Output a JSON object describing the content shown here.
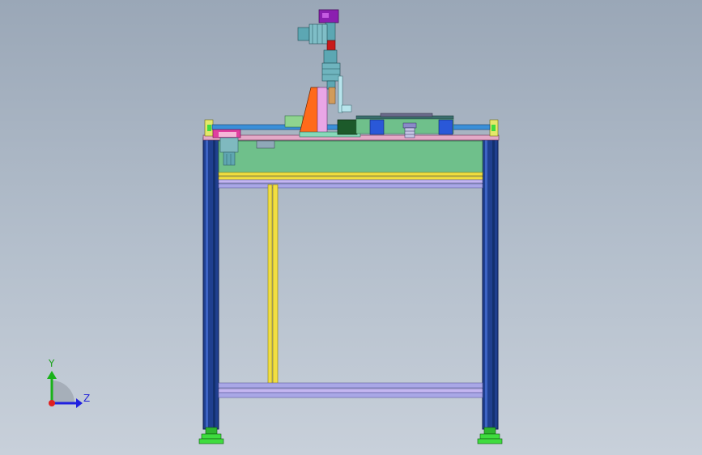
{
  "viewport": {
    "background_top": "#9aa7b7",
    "background_bottom": "#c8d0da"
  },
  "triad": {
    "y_label": "Y",
    "z_label": "Z",
    "x_color": "#e02020",
    "y_color": "#19b219",
    "z_color": "#2020e0"
  },
  "colors": {
    "frame_blue": "#1f3f8f",
    "frame_edge": "#0d1e52",
    "panel_green": "#6fc08b",
    "rail_yellow": "#f1de41",
    "rail_lavender": "#a9a7e6",
    "foot_green": "#3fdc3f",
    "top_pink": "#e4a9c7",
    "wedge_orange": "#ff6a1a",
    "motor_purple": "#8b1fb0",
    "motor_teal": "#5ca7b3",
    "tube_blue": "#3a8fd8",
    "block_blue": "#2a58d8"
  }
}
